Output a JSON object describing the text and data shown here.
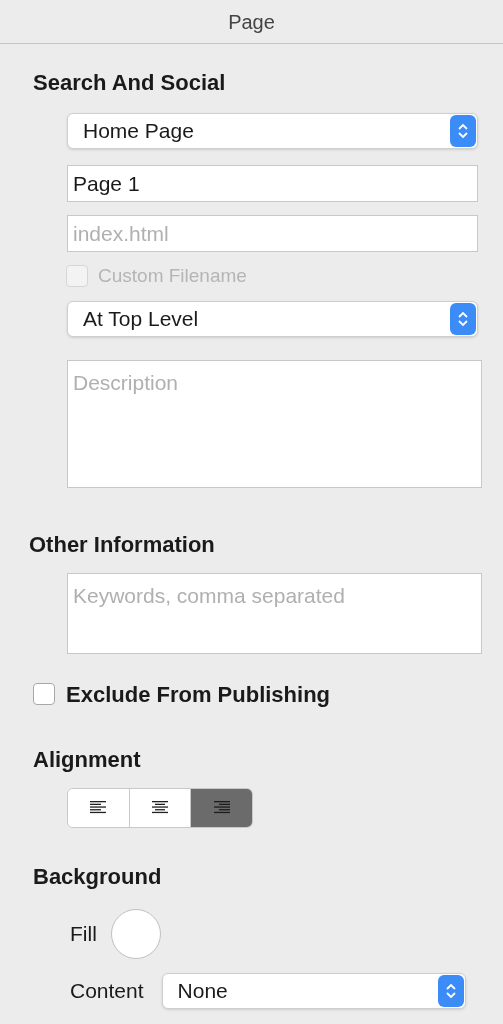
{
  "header": {
    "title": "Page"
  },
  "search_and_social": {
    "heading": "Search And Social",
    "page_type": {
      "value": "Home Page"
    },
    "page_name": {
      "value": "Page 1"
    },
    "filename": {
      "placeholder": "index.html"
    },
    "custom_filename": {
      "label": "Custom Filename",
      "checked": false,
      "disabled": true
    },
    "level": {
      "value": "At Top Level"
    },
    "description": {
      "placeholder": "Description"
    }
  },
  "other_information": {
    "heading": "Other Information",
    "keywords": {
      "placeholder": "Keywords, comma separated"
    }
  },
  "exclude_from_publishing": {
    "label": "Exclude From Publishing",
    "checked": false,
    "disabled": false
  },
  "alignment": {
    "heading": "Alignment",
    "options": [
      {
        "kind": "left",
        "selected": false
      },
      {
        "kind": "center",
        "selected": false
      },
      {
        "kind": "right",
        "selected": true
      }
    ]
  },
  "background": {
    "heading": "Background",
    "fill_label": "Fill",
    "content_label": "Content",
    "content": {
      "value": "None"
    }
  }
}
